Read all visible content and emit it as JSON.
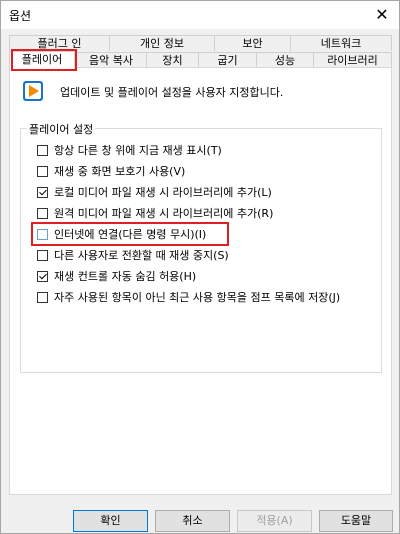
{
  "window": {
    "title": "옵션",
    "close_glyph": "✕"
  },
  "tabs": {
    "top": [
      "플러그 인",
      "개인 정보",
      "보안",
      "네트워크"
    ],
    "bottom": [
      "플레이어",
      "음악 복사",
      "장치",
      "굽기",
      "성능",
      "라이브러리"
    ],
    "selected": "플레이어"
  },
  "panel": {
    "icon": "windows-media-player-icon",
    "description": "업데이트 및 플레이어 설정을 사용자 지정합니다.",
    "group_title": "플레이어 설정",
    "options": [
      {
        "label": "항상 다른 창 위에 지금 재생 표시(T)",
        "checked": false
      },
      {
        "label": "재생 중 화면 보호기 사용(V)",
        "checked": false
      },
      {
        "label": "로컬 미디어 파일 재생 시 라이브러리에 추가(L)",
        "checked": true
      },
      {
        "label": "원격 미디어 파일 재생 시 라이브러리에 추가(R)",
        "checked": false
      },
      {
        "label": "인터넷에 연결(다른 명령 무시)(I)",
        "checked": false
      },
      {
        "label": "다른 사용자로 전환할 때 재생 중지(S)",
        "checked": false
      },
      {
        "label": "재생 컨트롤 자동 숨김 허용(H)",
        "checked": true
      },
      {
        "label": "자주 사용된 항목이 아닌 최근 사용 항목을 점프 목록에 저장(J)",
        "checked": false
      }
    ]
  },
  "buttons": {
    "ok": "확인",
    "cancel": "취소",
    "apply": "적용(A)",
    "help": "도움말"
  },
  "colors": {
    "highlight": "#e02020",
    "accent": "#0078d7"
  }
}
